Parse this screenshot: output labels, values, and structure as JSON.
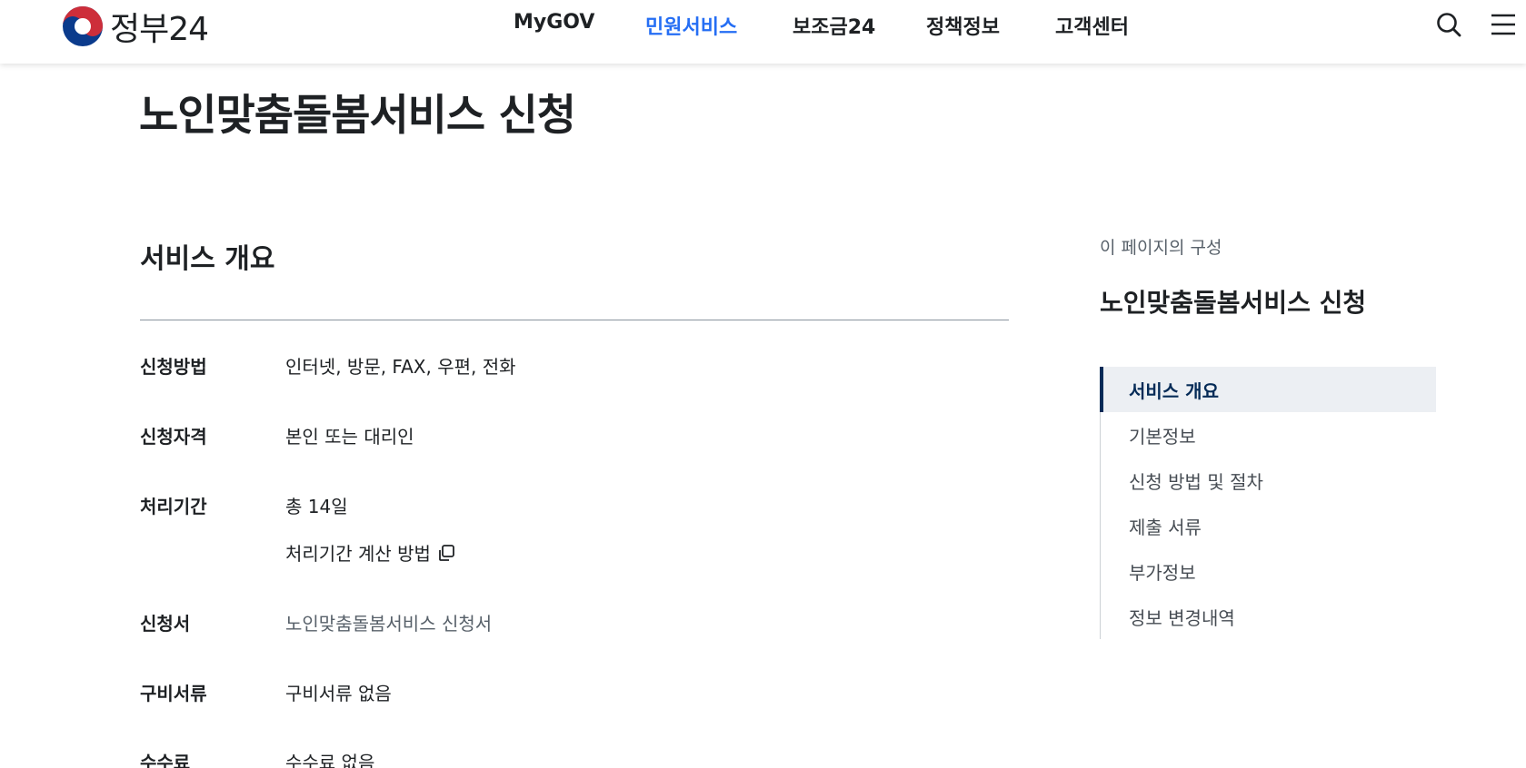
{
  "header": {
    "logo_text": "정부24",
    "nav": [
      {
        "label": "MyGOV",
        "active": false
      },
      {
        "label": "민원서비스",
        "active": true
      },
      {
        "label": "보조금24",
        "active": false
      },
      {
        "label": "정책정보",
        "active": false
      },
      {
        "label": "고객센터",
        "active": false
      }
    ],
    "icons": [
      "search-icon",
      "menu-icon"
    ],
    "accent_color": "#256ef4"
  },
  "page_title": "노인맞춤돌봄서비스 신청",
  "overview": {
    "title": "서비스 개요",
    "rows": [
      {
        "label": "신청방법",
        "value": "인터넷, 방문, FAX, 우편, 전화"
      },
      {
        "label": "신청자격",
        "value": "본인 또는 대리인"
      },
      {
        "label": "처리기간",
        "value": "총 14일",
        "sub_link": "처리기간 계산 방법"
      },
      {
        "label": "신청서",
        "value": "노인맞춤돌봄서비스 신청서"
      },
      {
        "label": "구비서류",
        "value": "구비서류 없음"
      },
      {
        "label": "수수료",
        "value": "수수료 없음"
      }
    ]
  },
  "toc": {
    "caption": "이 페이지의 구성",
    "title": "노인맞춤돌봄서비스 신청",
    "items": [
      {
        "label": "서비스 개요",
        "active": true
      },
      {
        "label": "기본정보",
        "active": false
      },
      {
        "label": "신청 방법 및 절차",
        "active": false
      },
      {
        "label": "제출 서류",
        "active": false
      },
      {
        "label": "부가정보",
        "active": false
      },
      {
        "label": "정보 변경내역",
        "active": false
      }
    ],
    "active_color": "#052b57"
  }
}
